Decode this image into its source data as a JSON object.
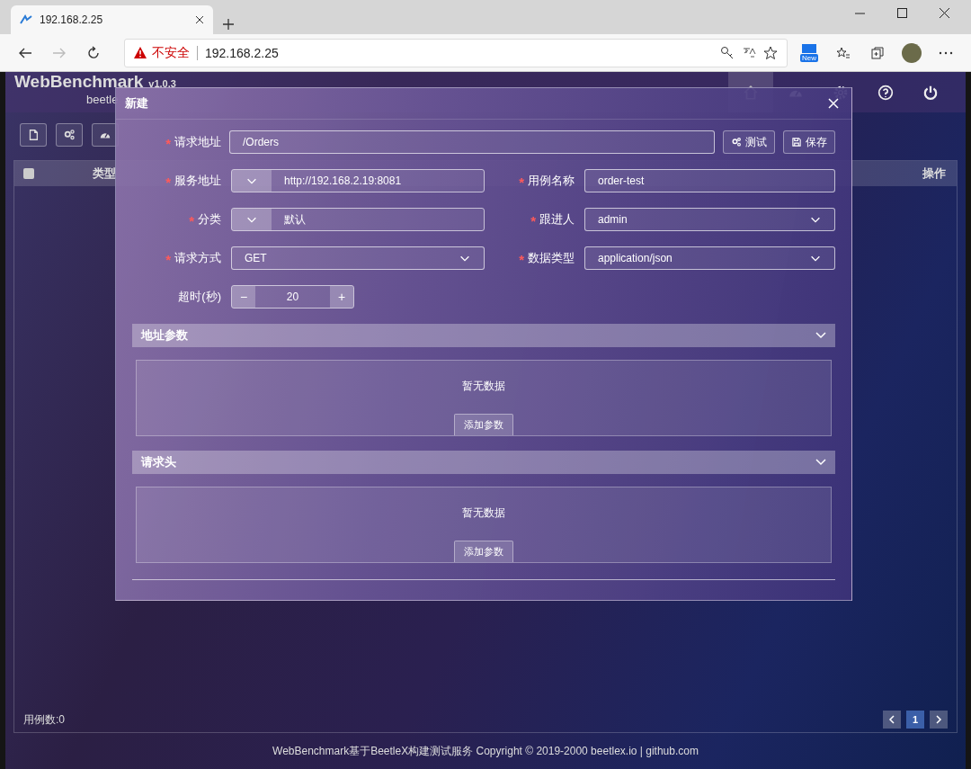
{
  "browser": {
    "tab_title": "192.168.2.25",
    "security_label": "不安全",
    "url": "192.168.2.25",
    "new_badge": "New"
  },
  "app": {
    "logo": "WebBenchmark",
    "version": "v1.0.3",
    "subtitle": "beetle",
    "nav": [
      {
        "kind": "home",
        "selected": true
      },
      {
        "kind": "gauge",
        "selected": false
      },
      {
        "kind": "gear",
        "selected": false
      },
      {
        "kind": "help",
        "selected": false
      },
      {
        "kind": "power",
        "selected": false
      }
    ],
    "toolbar": [
      {
        "kind": "file"
      },
      {
        "kind": "gears"
      },
      {
        "kind": "gauge"
      }
    ],
    "table": {
      "select_all_checked": false,
      "columns": [
        "类型",
        "操作"
      ]
    },
    "case_count": "用例数:0",
    "pages": [
      {
        "label": "1",
        "selected": true
      }
    ],
    "copyright": "WebBenchmark基于BeetleX构建测试服务 Copyright © 2019-2000 beetlex.io | github.com"
  },
  "dialog": {
    "title": "新建",
    "required_mark": "*",
    "request_url": {
      "label": "请求地址",
      "required": true,
      "value": "/Orders"
    },
    "actions": [
      {
        "kind": "gears",
        "label": "测试"
      },
      {
        "kind": "save",
        "label": "保存"
      }
    ],
    "fields": [
      {
        "kind": "combo",
        "label": "服务地址",
        "required": true,
        "value": "http://192.168.2.19:8081"
      },
      {
        "kind": "text",
        "label": "用例名称",
        "required": true,
        "value": "order-test"
      },
      {
        "kind": "combo",
        "label": "分类",
        "required": true,
        "value": "默认"
      },
      {
        "kind": "select",
        "label": "跟进人",
        "required": true,
        "value": "admin"
      },
      {
        "kind": "select",
        "label": "请求方式",
        "required": true,
        "value": "GET"
      },
      {
        "kind": "select",
        "label": "数据类型",
        "required": true,
        "value": "application/json"
      },
      {
        "kind": "stepper",
        "label": "超时(秒)",
        "required": false,
        "value": "20",
        "minus": "−",
        "plus": "+"
      }
    ],
    "sections": [
      {
        "title": "地址参数",
        "expanded": true,
        "empty_text": "暂无数据",
        "button": "添加参数"
      },
      {
        "title": "请求头",
        "expanded": true,
        "empty_text": "暂无数据",
        "button": "添加参数"
      }
    ]
  }
}
